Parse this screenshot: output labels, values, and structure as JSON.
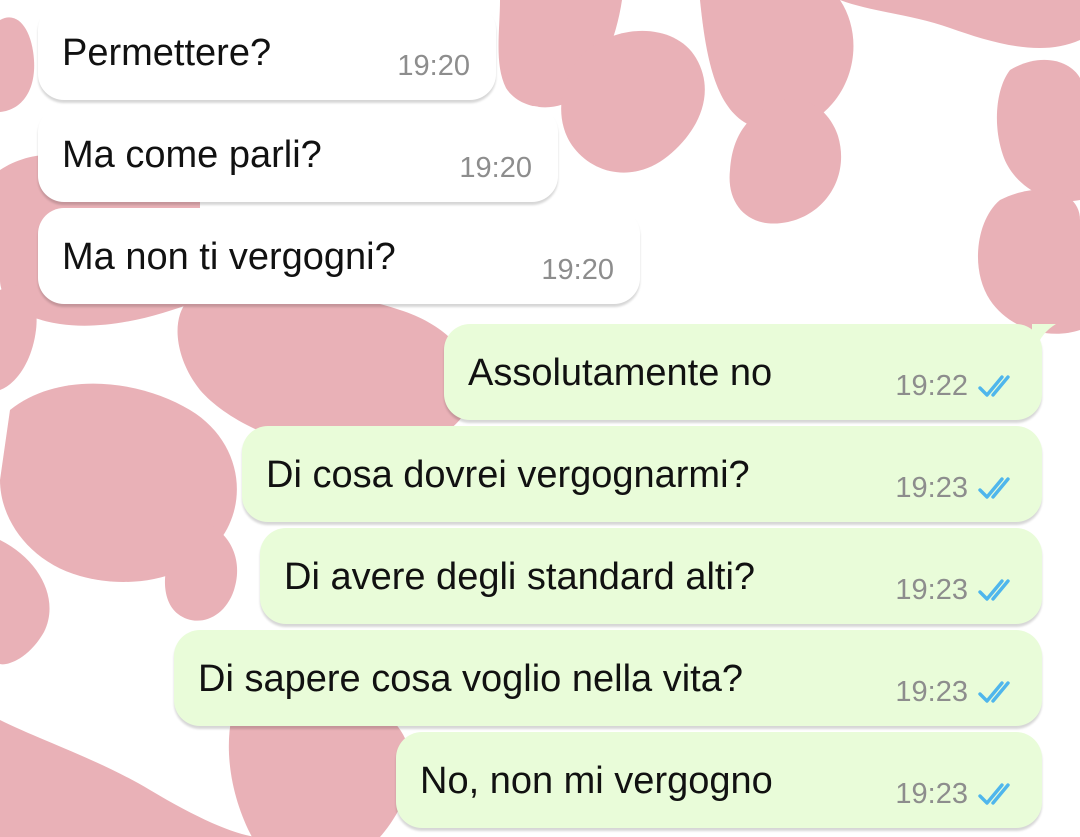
{
  "colors": {
    "wallpaper_spot": "#e9b1b7",
    "incoming_bubble": "#ffffff",
    "outgoing_bubble": "#e9fcd9",
    "timestamp": "#8d8d8d",
    "read_ticks": "#4fb6ec"
  },
  "messages": [
    {
      "direction": "incoming",
      "text": "Permettere?",
      "time": "19:20"
    },
    {
      "direction": "incoming",
      "text": "Ma come parli?",
      "time": "19:20"
    },
    {
      "direction": "incoming",
      "text": "Ma non ti vergogni?",
      "time": "19:20"
    },
    {
      "direction": "outgoing",
      "text": "Assolutamente no",
      "time": "19:22",
      "status": "read-double-check-icon"
    },
    {
      "direction": "outgoing",
      "text": "Di cosa dovrei vergognarmi?",
      "time": "19:23",
      "status": "read-double-check-icon"
    },
    {
      "direction": "outgoing",
      "text": "Di avere degli standard alti?",
      "time": "19:23",
      "status": "read-double-check-icon"
    },
    {
      "direction": "outgoing",
      "text": "Di sapere cosa voglio nella vita?",
      "time": "19:23",
      "status": "read-double-check-icon"
    },
    {
      "direction": "outgoing",
      "text": "No, non mi vergogno",
      "time": "19:23",
      "status": "read-double-check-icon"
    }
  ]
}
